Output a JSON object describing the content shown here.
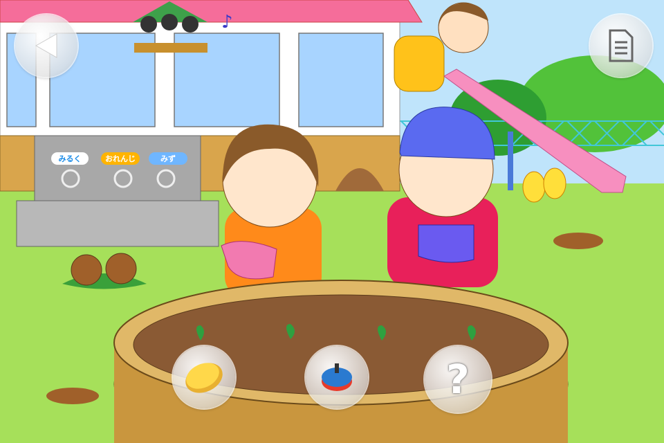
{
  "scene": "kindergarten-garden",
  "faucet_labels": [
    {
      "label": "みるく",
      "bg": "#ffffff",
      "color": "#1a8ce8"
    },
    {
      "label": "おれんじ",
      "bg": "#ffb400",
      "color": "#ffffff"
    },
    {
      "label": "みず",
      "bg": "#6fb6ff",
      "color": "#ffffff"
    }
  ],
  "buttons": {
    "back": {
      "icon": "back-arrow-icon"
    },
    "menu": {
      "icon": "document-icon"
    },
    "items": [
      {
        "icon": "coin-icon"
      },
      {
        "icon": "spinning-top-icon"
      },
      {
        "icon": "question-mark-icon",
        "label": "?"
      }
    ]
  },
  "colors": {
    "sky": "#bfe4fb",
    "grass": "#a6e05a",
    "roof": "#f56d9a",
    "soil": "#8a5a34",
    "brick": "#d9b064"
  }
}
